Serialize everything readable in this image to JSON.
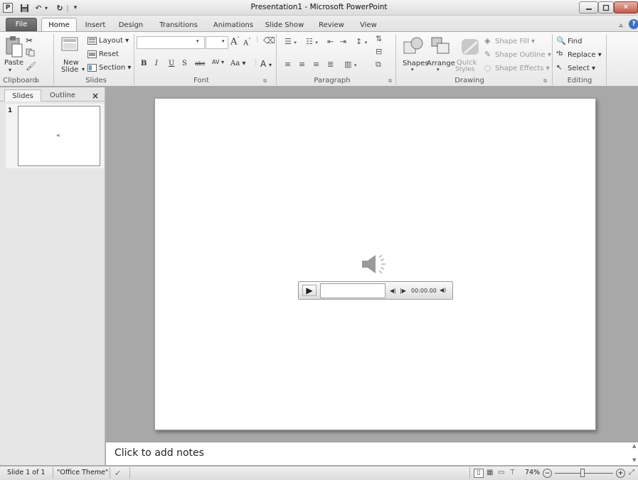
{
  "window": {
    "title": "Presentation1  -  Microsoft PowerPoint",
    "app_icon": "P"
  },
  "tabs": [
    "File",
    "Home",
    "Insert",
    "Design",
    "Transitions",
    "Animations",
    "Slide Show",
    "Review",
    "View"
  ],
  "clipboard": {
    "paste": "Paste",
    "label": "Clipboard"
  },
  "slides_group": {
    "new_slide_line1": "New",
    "new_slide_line2": "Slide",
    "layout": "Layout",
    "reset": "Reset",
    "section": "Section",
    "label": "Slides"
  },
  "font_group": {
    "label": "Font",
    "bold": "B",
    "italic": "I",
    "underline": "U",
    "shadow": "S",
    "strike": "abc",
    "spacing": "AV",
    "case": "Aa",
    "color": "A",
    "grow": "A",
    "shrink": "A"
  },
  "paragraph_group": {
    "label": "Paragraph"
  },
  "drawing_group": {
    "shapes": "Shapes",
    "arrange": "Arrange",
    "quick_styles_line1": "Quick",
    "quick_styles_line2": "Styles",
    "shape_fill": "Shape Fill",
    "shape_outline": "Shape Outline",
    "shape_effects": "Shape Effects",
    "label": "Drawing"
  },
  "editing_group": {
    "find": "Find",
    "replace": "Replace",
    "select": "Select",
    "label": "Editing"
  },
  "pane": {
    "tab_slides": "Slides",
    "tab_outline": "Outline",
    "close": "×",
    "slide_number": "1"
  },
  "player": {
    "time": "00:00.00"
  },
  "notes": {
    "placeholder": "Click to add notes"
  },
  "status": {
    "slide_info": "Slide 1 of 1",
    "theme": "\"Office Theme\"",
    "zoom": "74%"
  },
  "colors": {
    "file_tab": "#6a6a6a",
    "slide_bg": "#ffffff",
    "workspace": "#a8a8a8"
  }
}
